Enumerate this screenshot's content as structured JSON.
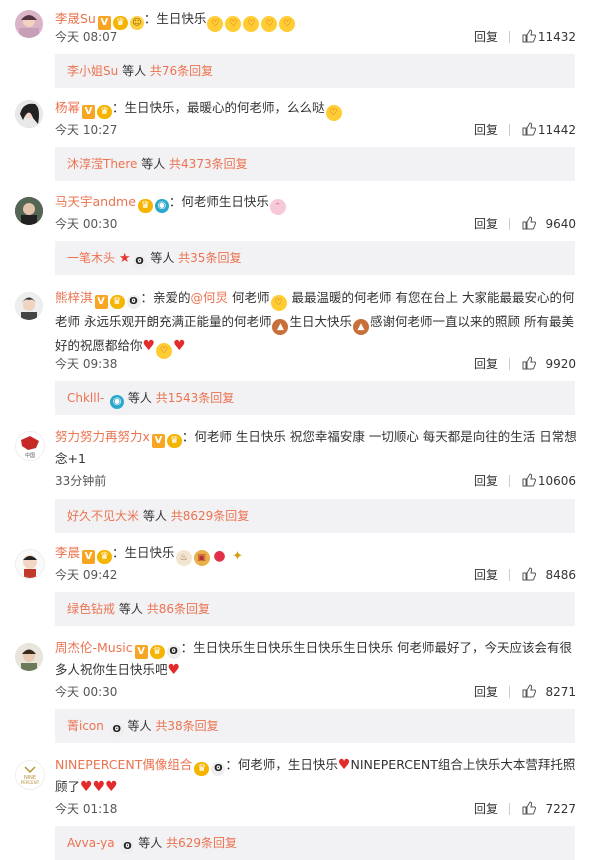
{
  "ui": {
    "reply_label": "回复",
    "others_label": "等人"
  },
  "comments": [
    {
      "user": "李晟Su",
      "text": "：生日快乐",
      "time": "今天 08:07",
      "likes": "11432",
      "sub_user": "李小姐Su",
      "sub_count": "共76条回复"
    },
    {
      "user": "杨幂",
      "text": "：生日快乐，最暖心的何老师，么么哒",
      "time": "今天 10:27",
      "likes": "11442",
      "sub_user": "沐淳滢There",
      "sub_count": "共4373条回复"
    },
    {
      "user": "马天宇andme",
      "text": "：何老师生日快乐",
      "time": "今天 00:30",
      "likes": "9640",
      "sub_user": "一笔木头",
      "sub_count": "共35条回复"
    },
    {
      "user": "熊梓淇",
      "text_a": "：亲爱的",
      "mention": "@何炅",
      "text_b": " 何老师",
      "text_c": " 最最温暖的何老师 有您在台上 大家能最最安心的何老师 永远乐观开朗充满正能量的何老师",
      "text_d": "生日大快乐",
      "text_e": "感谢何老师一直以来的照顾 所有最美好的祝愿都给你",
      "time": "今天 09:38",
      "likes": "9920",
      "sub_user": "Chklll-",
      "sub_count": "共1543条回复"
    },
    {
      "user": "努力努力再努力x",
      "text": "：何老师 生日快乐 祝您幸福安康 一切顺心 每天都是向往的生活 日常想念+1",
      "time": "33分钟前",
      "likes": "10606",
      "sub_user": "好久不见大米",
      "sub_count": "共8629条回复"
    },
    {
      "user": "李晨",
      "text": "：生日快乐",
      "time": "今天 09:42",
      "likes": "8486",
      "sub_user": "绿色钻戒",
      "sub_count": "共86条回复"
    },
    {
      "user": "周杰伦-Music",
      "text": "：生日快乐生日快乐生日快乐生日快乐 何老师最好了，今天应该会有很多人祝你生日快乐吧",
      "time": "今天 00:30",
      "likes": "8271",
      "sub_user": "菁icon",
      "sub_count": "共38条回复"
    },
    {
      "user": "NINEPERCENT偶像组合",
      "text_a": "：何老师，生日快乐",
      "text_b": "NINEPERCENT组合上快乐大本营拜托照顾了",
      "time": "今天 01:18",
      "likes": "7227",
      "sub_user": "Avva-ya",
      "sub_count": "共629条回复"
    }
  ]
}
